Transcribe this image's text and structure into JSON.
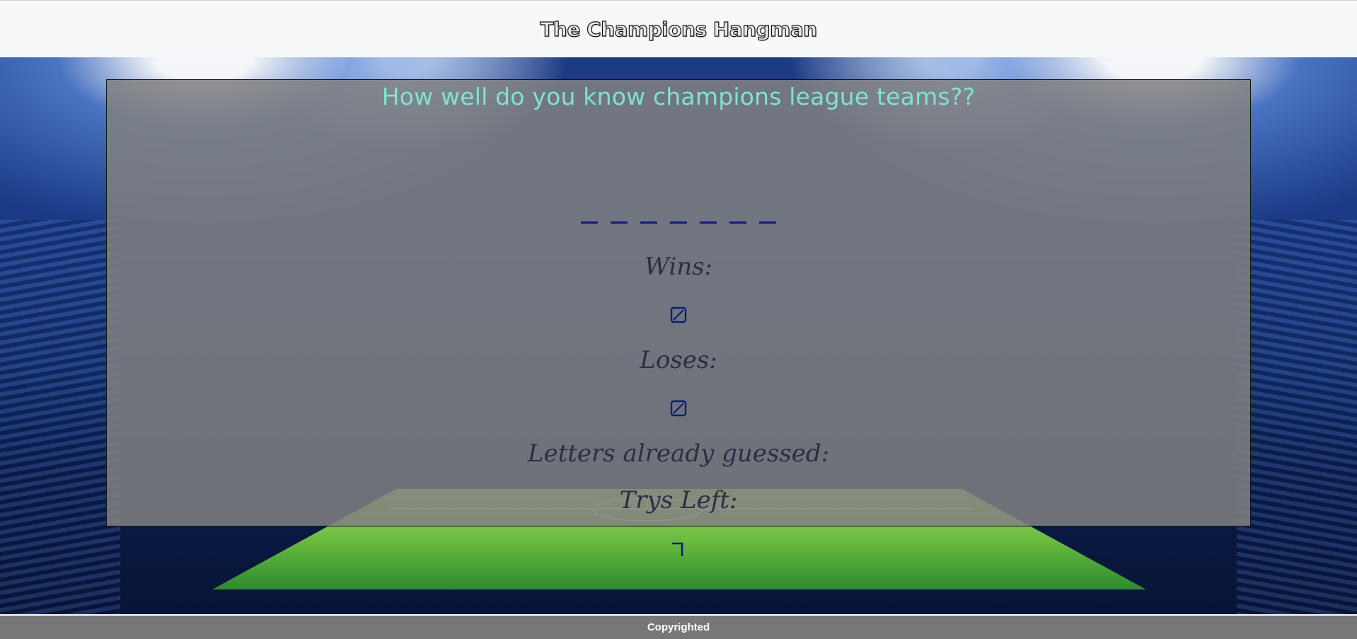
{
  "header": {
    "title": "The Champions Hangman"
  },
  "game": {
    "heading": "How well do you know champions league teams??",
    "word_blanks": [
      "_",
      "_",
      "_",
      "_",
      "_",
      "_",
      "_"
    ],
    "wins_label": "Wins:",
    "wins_value_icon": "missing-glyph-icon",
    "loses_label": "Loses:",
    "loses_value_icon": "missing-glyph-icon",
    "letters_guessed_label": "Letters already guessed:",
    "trys_left_label": "Trys Left:",
    "trys_left_value_icon": "corner-glyph-icon"
  },
  "footer": {
    "text": "Copyrighted"
  },
  "colors": {
    "heading": "#7fe4cf",
    "blank": "#111a7a",
    "label": "#2a2f43",
    "footer_bg": "#777777"
  }
}
